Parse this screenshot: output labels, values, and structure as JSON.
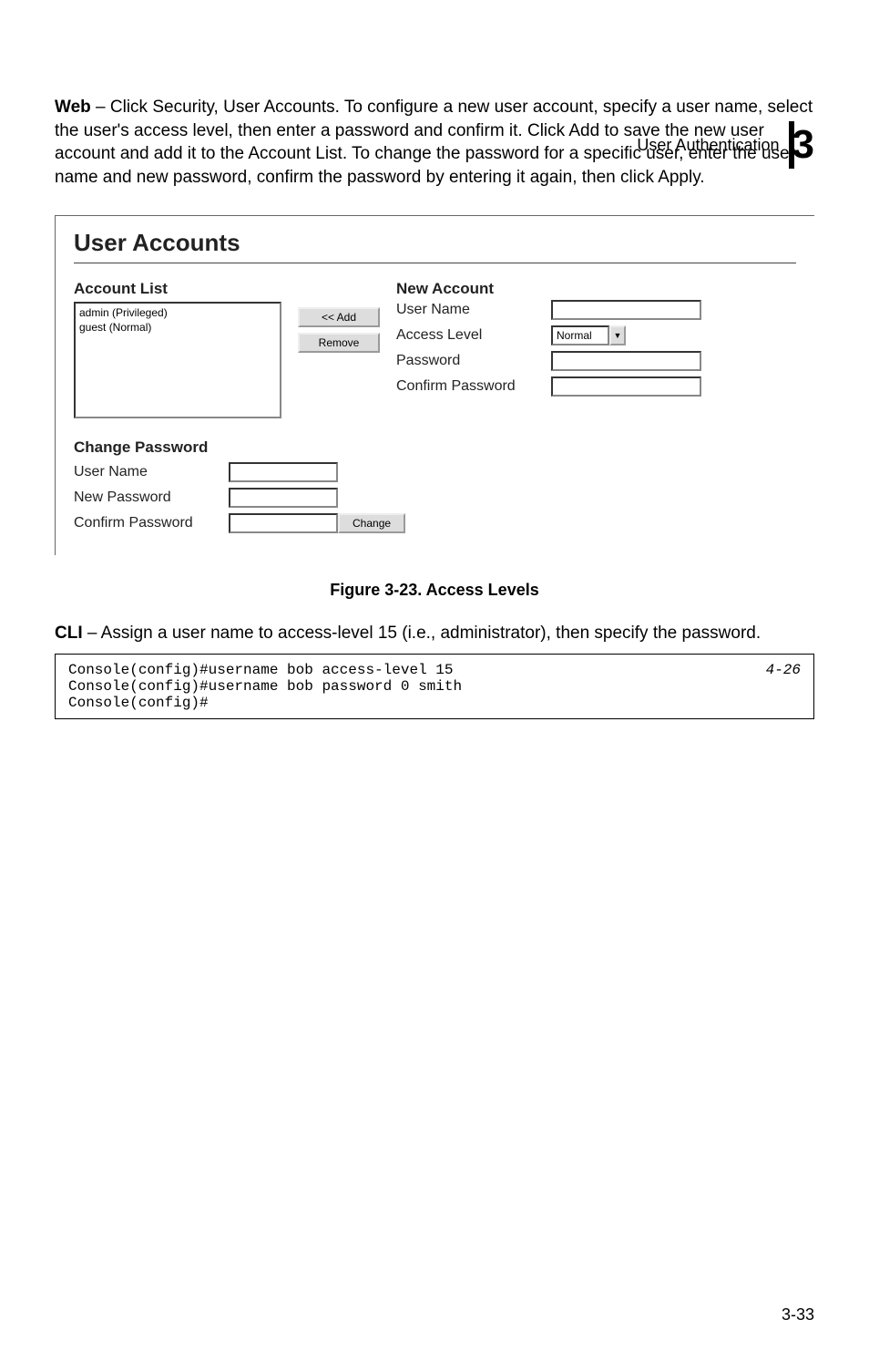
{
  "header": {
    "section": "User Authentication",
    "chapter": "3"
  },
  "intro": {
    "label": "Web",
    "text": " – Click Security, User Accounts. To configure a new user account, specify a user name, select the user's access level, then enter a password and confirm it. Click Add to save the new user account and add it to the Account List. To change the password for a specific user, enter the user name and new password, confirm the password by entering it again, then click Apply."
  },
  "ui": {
    "title": "User Accounts",
    "account_list": {
      "heading": "Account List",
      "items": [
        "admin (Privileged)",
        "guest (Normal)"
      ]
    },
    "buttons": {
      "add": "<< Add",
      "remove": "Remove"
    },
    "new_account": {
      "heading": "New Account",
      "fields": {
        "user_name": "User Name",
        "access_level": "Access Level",
        "password": "Password",
        "confirm": "Confirm Password"
      },
      "access_selected": "Normal"
    },
    "change_pw": {
      "heading": "Change Password",
      "fields": {
        "user_name": "User Name",
        "new_password": "New Password",
        "confirm": "Confirm Password"
      },
      "change_btn": "Change"
    }
  },
  "figure_caption": "Figure 3-23.  Access Levels",
  "cli_intro": {
    "label": "CLI",
    "text": " – Assign a user name to access-level 15 (i.e., administrator), then specify the password."
  },
  "cli": {
    "lines": "Console(config)#username bob access-level 15\nConsole(config)#username bob password 0 smith\nConsole(config)#",
    "ref": "4-26"
  },
  "page_number": "3-33"
}
